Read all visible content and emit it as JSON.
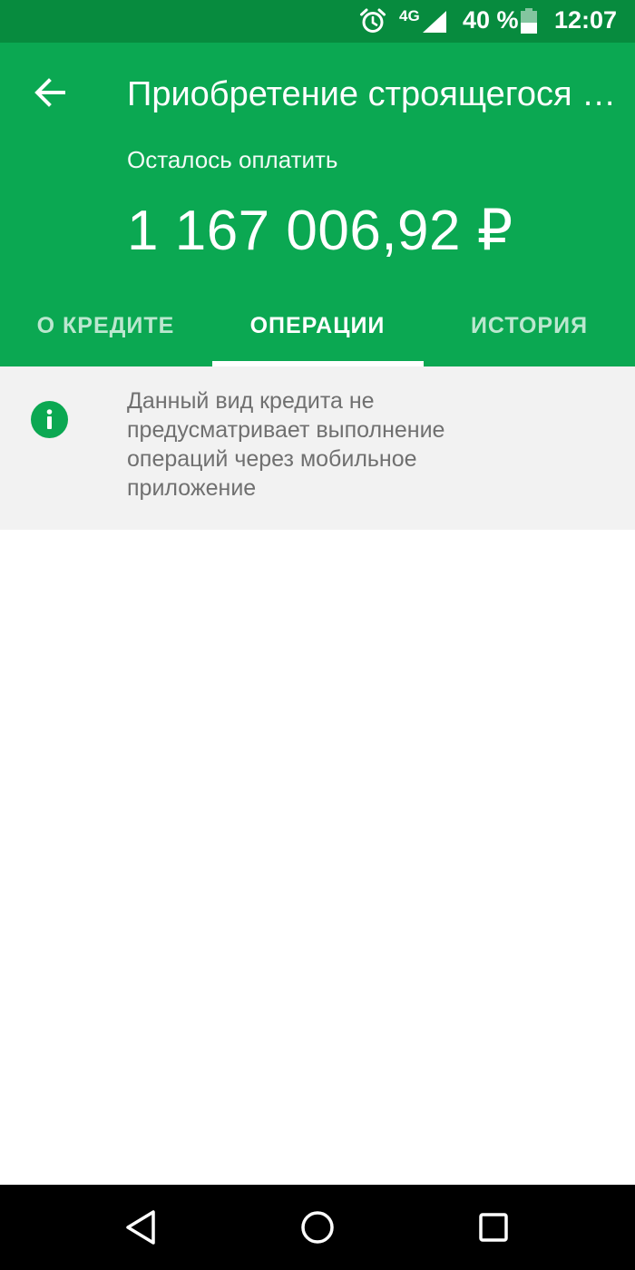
{
  "status_bar": {
    "network": "4G",
    "battery": "40 %",
    "time": "12:07",
    "icons": [
      "alarm-icon",
      "signal-icon",
      "battery-icon"
    ]
  },
  "header": {
    "back_icon": "arrow-left-icon",
    "title": "Приобретение строящегося жилья",
    "remaining_label": "Осталось оплатить",
    "amount": "1 167 006,92 ₽"
  },
  "tabs": [
    {
      "label": "О КРЕДИТЕ",
      "active": false
    },
    {
      "label": "ОПЕРАЦИИ",
      "active": true
    },
    {
      "label": "ИСТОРИЯ",
      "active": false
    }
  ],
  "info": {
    "icon": "info-icon",
    "text": "Данный вид кредита не предусматривает выполнение операций через мобильное приложение"
  },
  "nav_bar": {
    "icons": [
      "nav-back-icon",
      "nav-home-icon",
      "nav-recents-icon"
    ]
  },
  "colors": {
    "status_bar": "#078b3e",
    "header": "#0ba852",
    "accent": "#0ba852",
    "banner_bg": "#f2f2f2",
    "banner_text": "#707070"
  }
}
